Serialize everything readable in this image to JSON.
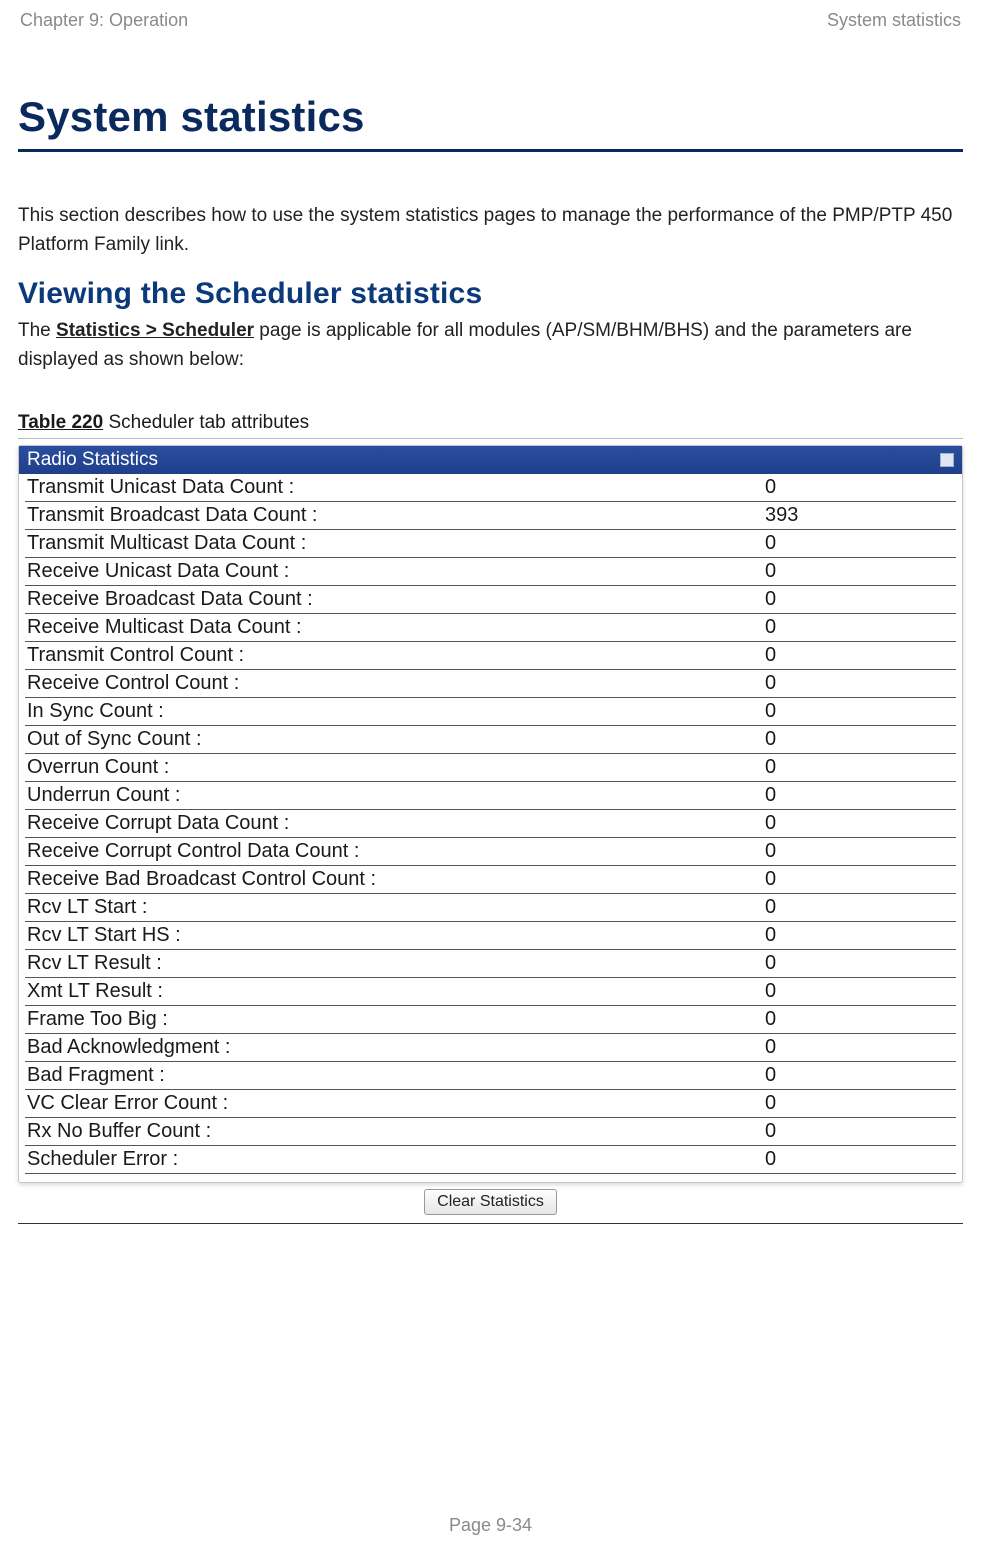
{
  "header": {
    "left": "Chapter 9:  Operation",
    "right": "System statistics"
  },
  "title": "System statistics",
  "intro": "This section describes how to use the system statistics pages to manage the performance of the PMP/PTP 450 Platform Family link.",
  "section_title": "Viewing the Scheduler statistics",
  "para_pre": "The ",
  "breadcrumb": "Statistics > Scheduler",
  "para_post": " page is applicable for all modules (AP/SM/BHM/BHS) and the parameters are displayed as shown below:",
  "caption_label": "Table 220",
  "caption_text": " Scheduler tab attributes",
  "panel": {
    "title": "Radio Statistics",
    "rows": [
      {
        "label": "Transmit Unicast Data Count :",
        "value": "0"
      },
      {
        "label": "Transmit Broadcast Data Count :",
        "value": "393"
      },
      {
        "label": "Transmit Multicast Data Count :",
        "value": "0"
      },
      {
        "label": "Receive Unicast Data Count :",
        "value": "0"
      },
      {
        "label": "Receive Broadcast Data Count :",
        "value": "0"
      },
      {
        "label": "Receive Multicast Data Count :",
        "value": "0"
      },
      {
        "label": "Transmit Control Count :",
        "value": "0"
      },
      {
        "label": "Receive Control Count :",
        "value": "0"
      },
      {
        "label": "In Sync Count :",
        "value": "0"
      },
      {
        "label": "Out of Sync Count :",
        "value": "0"
      },
      {
        "label": "Overrun Count :",
        "value": "0"
      },
      {
        "label": "Underrun Count :",
        "value": "0"
      },
      {
        "label": "Receive Corrupt Data Count :",
        "value": "0"
      },
      {
        "label": "Receive Corrupt Control Data Count :",
        "value": "0"
      },
      {
        "label": "Receive Bad Broadcast Control Count :",
        "value": "0"
      },
      {
        "label": "Rcv LT Start :",
        "value": "0"
      },
      {
        "label": "Rcv LT Start HS :",
        "value": "0"
      },
      {
        "label": "Rcv LT Result :",
        "value": "0"
      },
      {
        "label": "Xmt LT Result :",
        "value": "0"
      },
      {
        "label": "Frame Too Big :",
        "value": "0"
      },
      {
        "label": "Bad Acknowledgment :",
        "value": "0"
      },
      {
        "label": "Bad Fragment :",
        "value": "0"
      },
      {
        "label": "VC Clear Error Count :",
        "value": "0"
      },
      {
        "label": "Rx No Buffer Count :",
        "value": "0"
      },
      {
        "label": "Scheduler Error :",
        "value": "0"
      }
    ],
    "button": "Clear Statistics"
  },
  "page_number": "Page 9-34"
}
